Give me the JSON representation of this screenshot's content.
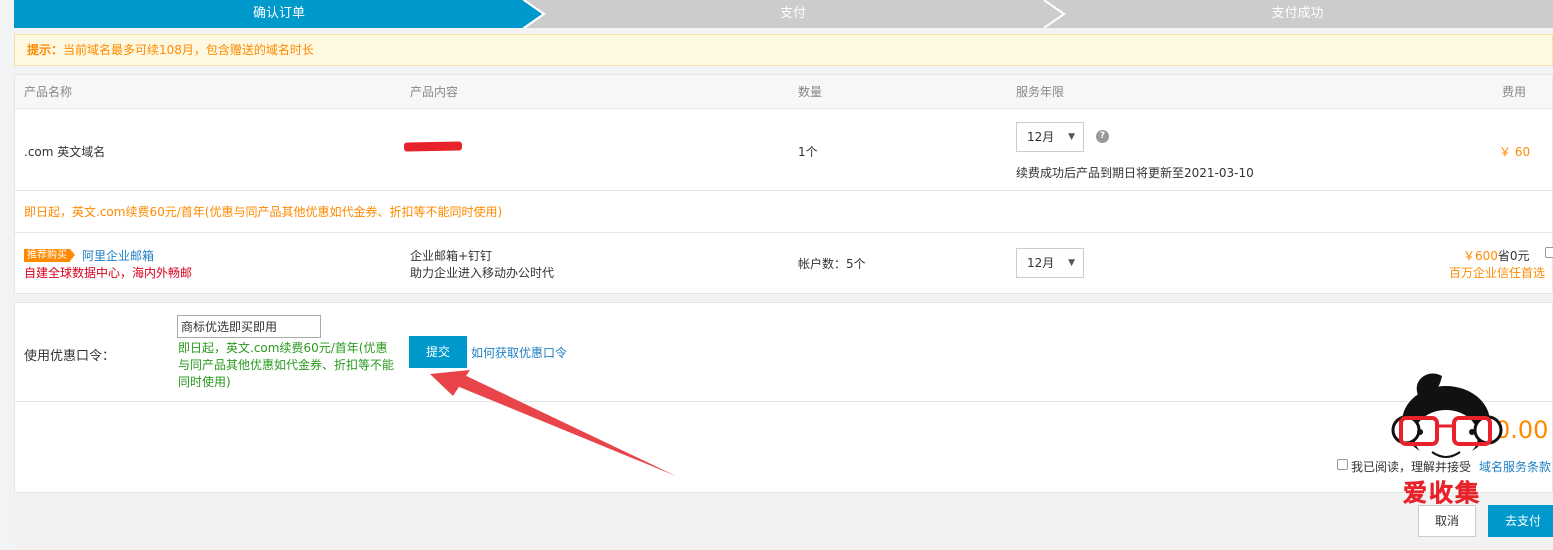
{
  "steps": [
    {
      "label": "确认订单"
    },
    {
      "label": "支付"
    },
    {
      "label": "支付成功"
    }
  ],
  "tip": {
    "prefix": "提示：",
    "text": "当前域名最多可续108月，包含赠送的域名时长"
  },
  "table": {
    "headers": [
      "产品名称",
      "产品内容",
      "数量",
      "服务年限",
      "费用"
    ],
    "row1": {
      "name": ".com 英文域名",
      "quantity": "1个",
      "period": "12月",
      "renew_note": "续费成功后产品到期日将更新至2021-03-10",
      "price": "￥ 60"
    },
    "promo": "即日起，英文.com续费60元/首年(优惠与同产品其他优惠如代金券、折扣等不能同时使用)",
    "row2": {
      "badge": "推荐购买",
      "name": "阿里企业邮箱",
      "slogan": "自建全球数据中心，海内外畅邮",
      "content1": "企业邮箱+钉钉",
      "content2": "助力企业进入移动办公时代",
      "quantity": "帐户数：5个",
      "period": "12月",
      "price": "￥600",
      "save": "省0元",
      "note": "百万企业信任首选"
    }
  },
  "coupon": {
    "label": "使用优惠口令：",
    "input_value": "商标优选即买即用",
    "hint": [
      "即日起，英文.com续费60元/首年(优惠",
      "与同产品其他优惠如代金券、折扣等不能",
      "同时使用)"
    ],
    "submit": "提交",
    "how_to": "如何获取优惠口令"
  },
  "summary": {
    "total_partial": "0.00",
    "agree_text": "我已阅读，理解并接受",
    "terms_link": "域名服务条款"
  },
  "footer": {
    "cancel": "取消",
    "pay": "去支付"
  },
  "watermark": {
    "text": "爱收集"
  },
  "icons": {
    "help": "help-icon",
    "dropdown": "chevron-down-icon",
    "arrow": "annotation-arrow"
  },
  "colors": {
    "accent": "#0099cc",
    "orange": "#ff8a00",
    "red": "#d9001b",
    "green": "#2a9a1e"
  }
}
